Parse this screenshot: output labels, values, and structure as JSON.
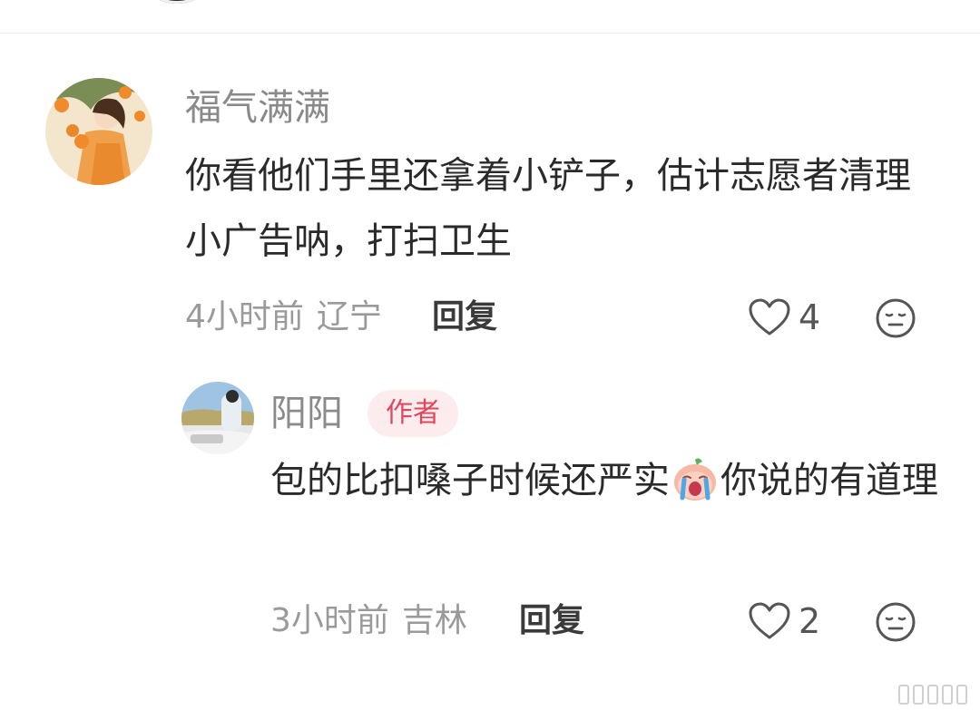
{
  "comments": [
    {
      "username": "福气满满",
      "text": "你看他们手里还拿着小铲子，估计志愿者清理小广告呐，打扫卫生",
      "time": "4小时前",
      "location": "辽宁",
      "reply_label": "回复",
      "likes": "4"
    }
  ],
  "replies": [
    {
      "username": "阳阳",
      "badge": "作者",
      "text_before_emoji": "包的比扣嗓子时候还严实",
      "emoji_name": "crying-face-emoji",
      "text_after_emoji": "你说的有道理",
      "time": "3小时前",
      "location": "吉林",
      "reply_label": "回复",
      "likes": "2"
    }
  ],
  "colors": {
    "username": "#8a8a8a",
    "text": "#2a2a2a",
    "meta": "#9a9a9a",
    "badge_bg": "#fdecee",
    "badge_text": "#e0475c"
  }
}
